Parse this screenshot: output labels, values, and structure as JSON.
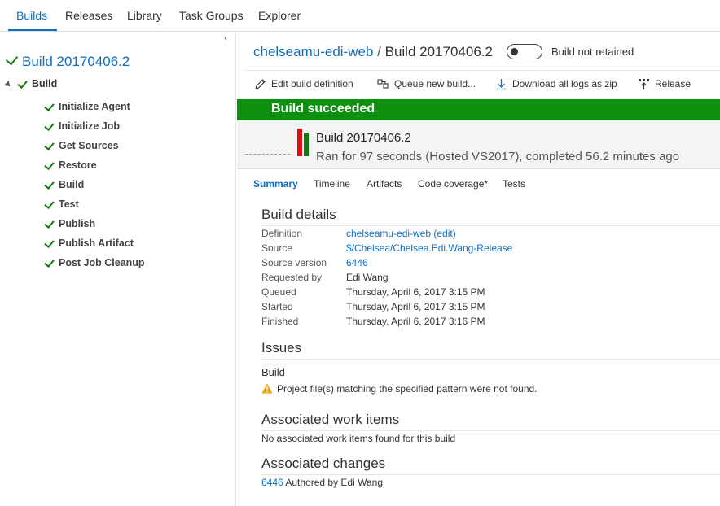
{
  "nav": {
    "tabs": [
      "Builds",
      "Releases",
      "Library",
      "Task Groups",
      "Explorer"
    ]
  },
  "left_panel": {
    "build_title": "Build 20170406.2",
    "phase_label": "Build",
    "steps": [
      "Initialize Agent",
      "Initialize Job",
      "Get Sources",
      "Restore",
      "Build",
      "Test",
      "Publish",
      "Publish Artifact",
      "Post Job Cleanup"
    ]
  },
  "header": {
    "pipeline": "chelseamu-edi-web",
    "separator": "/",
    "build_number": "Build 20170406.2",
    "retained_label": "Build not retained"
  },
  "toolbar": {
    "edit": "Edit build definition",
    "queue": "Queue new build...",
    "download": "Download all logs as zip",
    "release": "Release"
  },
  "banner": {
    "status": "Build succeeded"
  },
  "summary_box": {
    "build_number": "Build 20170406.2",
    "ran_text": "Ran for 97 seconds (Hosted VS2017), completed 56.2 minutes ago"
  },
  "subtabs": [
    "Summary",
    "Timeline",
    "Artifacts",
    "Code coverage*",
    "Tests"
  ],
  "build_details": {
    "heading": "Build details",
    "rows": [
      {
        "key": "Definition",
        "value": "chelseamu-edi-web (edit)"
      },
      {
        "key": "Source",
        "value": "$/Chelsea/Chelsea.Edi.Wang-Release"
      },
      {
        "key": "Source version",
        "value": "6446"
      },
      {
        "key": "Requested by",
        "value": "Edi Wang"
      },
      {
        "key": "Queued",
        "value": "Thursday, April 6, 2017 3:15 PM"
      },
      {
        "key": "Started",
        "value": "Thursday, April 6, 2017 3:15 PM"
      },
      {
        "key": "Finished",
        "value": "Thursday, April 6, 2017 3:16 PM"
      }
    ]
  },
  "issues": {
    "heading": "Issues",
    "group": "Build",
    "warning": "Project file(s) matching the specified pattern were not found."
  },
  "work_items": {
    "heading": "Associated work items",
    "text": "No associated work items found for this build"
  },
  "changes": {
    "heading": "Associated changes",
    "changeset": "6446",
    "text": "Authored by Edi Wang"
  },
  "colors": {
    "accent": "#106ebe",
    "success": "#0f8f0f",
    "check": "#107c10",
    "warning": "#e8a317"
  }
}
